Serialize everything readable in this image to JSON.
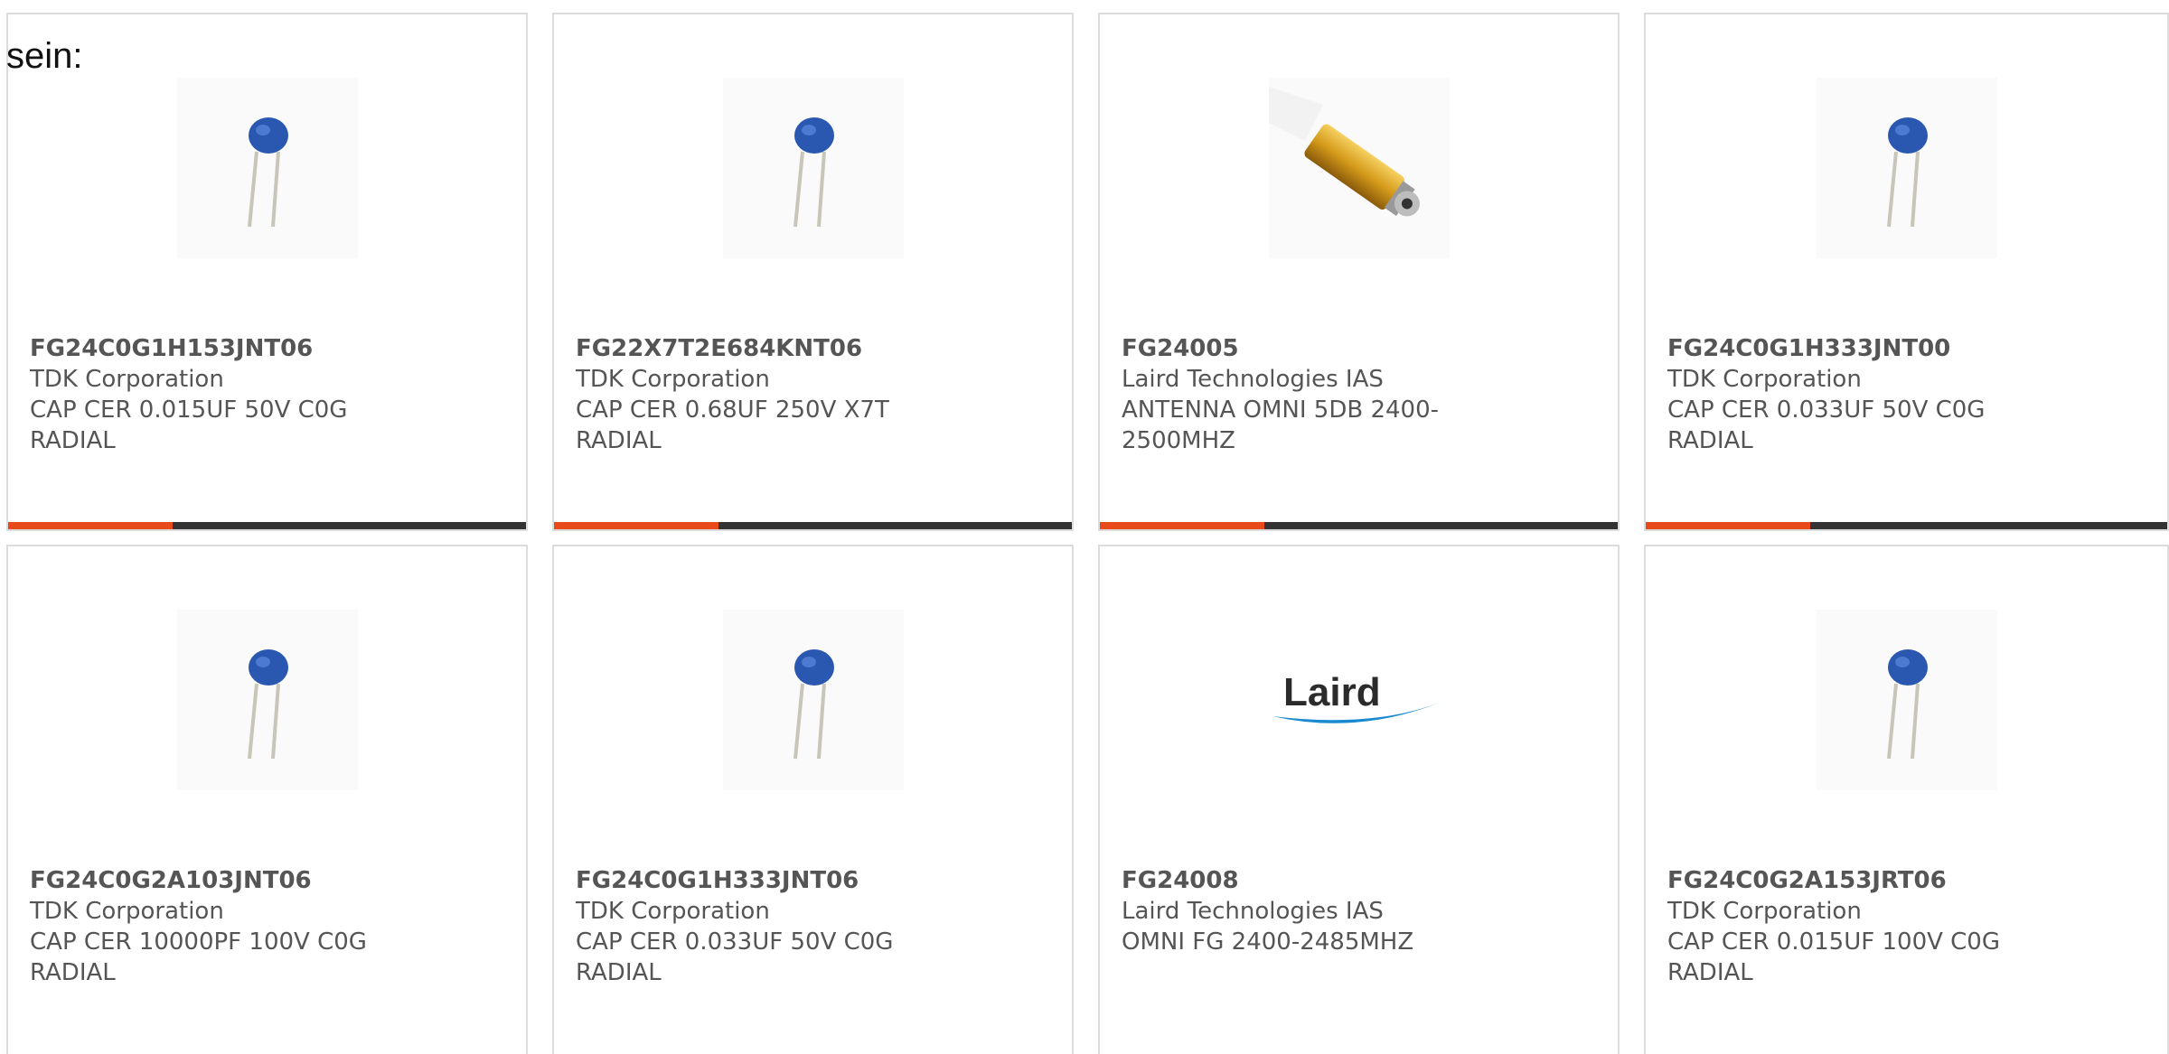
{
  "lead_text": "sein:",
  "products": [
    {
      "part_number": "FG24C0G1H153JNT06",
      "manufacturer": "TDK Corporation",
      "desc_line1": "CAP CER 0.015UF 50V C0G",
      "desc_line2": "RADIAL",
      "image": "ceramic-capacitor-icon"
    },
    {
      "part_number": "FG22X7T2E684KNT06",
      "manufacturer": "TDK Corporation",
      "desc_line1": "CAP CER 0.68UF 250V X7T",
      "desc_line2": "RADIAL",
      "image": "ceramic-capacitor-icon"
    },
    {
      "part_number": "FG24005",
      "manufacturer": "Laird Technologies IAS",
      "desc_line1": "ANTENNA OMNI 5DB 2400-",
      "desc_line2": "2500MHZ",
      "image": "antenna-connector-icon"
    },
    {
      "part_number": "FG24C0G1H333JNT00",
      "manufacturer": "TDK Corporation",
      "desc_line1": "CAP CER 0.033UF 50V C0G",
      "desc_line2": "RADIAL",
      "image": "ceramic-capacitor-icon"
    },
    {
      "part_number": "FG24C0G2A103JNT06",
      "manufacturer": "TDK Corporation",
      "desc_line1": "CAP CER 10000PF 100V C0G",
      "desc_line2": "RADIAL",
      "image": "ceramic-capacitor-icon"
    },
    {
      "part_number": "FG24C0G1H333JNT06",
      "manufacturer": "TDK Corporation",
      "desc_line1": "CAP CER 0.033UF 50V C0G",
      "desc_line2": "RADIAL",
      "image": "ceramic-capacitor-icon"
    },
    {
      "part_number": "FG24008",
      "manufacturer": "Laird Technologies IAS",
      "desc_line1": "OMNI FG 2400-2485MHZ",
      "desc_line2": "",
      "image": "laird-logo",
      "logo_text": "Laird"
    },
    {
      "part_number": "FG24C0G2A153JRT06",
      "manufacturer": "TDK Corporation",
      "desc_line1": "CAP CER 0.015UF 100V C0G",
      "desc_line2": "RADIAL",
      "image": "ceramic-capacitor-icon"
    }
  ],
  "colors": {
    "accent": "#e84a1a",
    "bar": "#333333",
    "text": "#555555",
    "border": "#dcdcdc",
    "capacitor_blue": "#2a58b0"
  }
}
